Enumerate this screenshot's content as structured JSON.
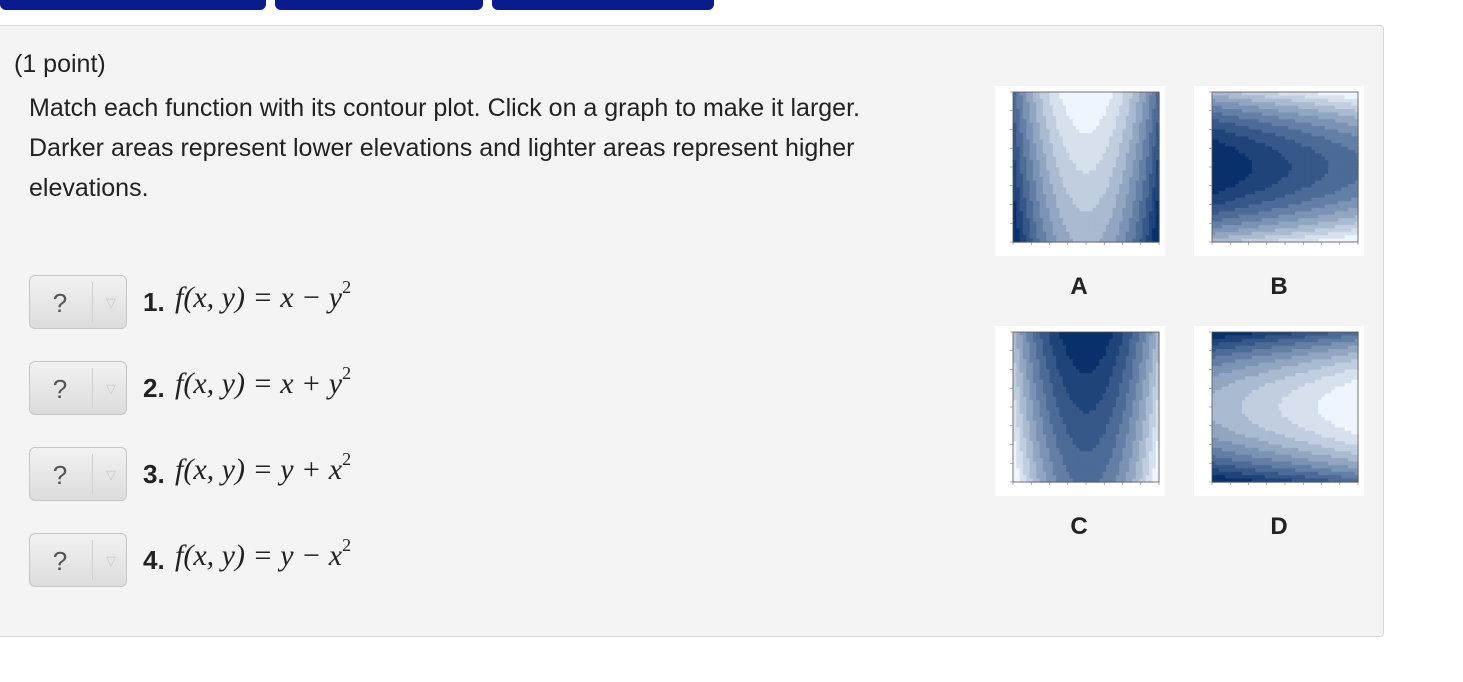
{
  "nav": {
    "tabs": [
      "",
      "",
      ""
    ]
  },
  "problem": {
    "points": "(1 point)",
    "instructions": "Match each function with its contour plot. Click on a graph to make it larger. Darker areas represent lower elevations and lighter areas represent higher elevations."
  },
  "questions": [
    {
      "select_value": "?",
      "number": "1.",
      "formula_main": "f(x, y) = x − y",
      "formula_exp": "2"
    },
    {
      "select_value": "?",
      "number": "2.",
      "formula_main": "f(x, y) = x + y",
      "formula_exp": "2"
    },
    {
      "select_value": "?",
      "number": "3.",
      "formula_main": "f(x, y) = y + x",
      "formula_exp": "2"
    },
    {
      "select_value": "?",
      "number": "4.",
      "formula_main": "f(x, y) = y − x",
      "formula_exp": "2"
    }
  ],
  "graphs": [
    {
      "label": "A"
    },
    {
      "label": "B"
    },
    {
      "label": "C"
    },
    {
      "label": "D"
    }
  ],
  "colors": {
    "nav_tab": "#0b1a8c",
    "contour_dark": "#08306b",
    "contour_light": "#eef5fc",
    "panel_bg": "#f4f4f4"
  }
}
